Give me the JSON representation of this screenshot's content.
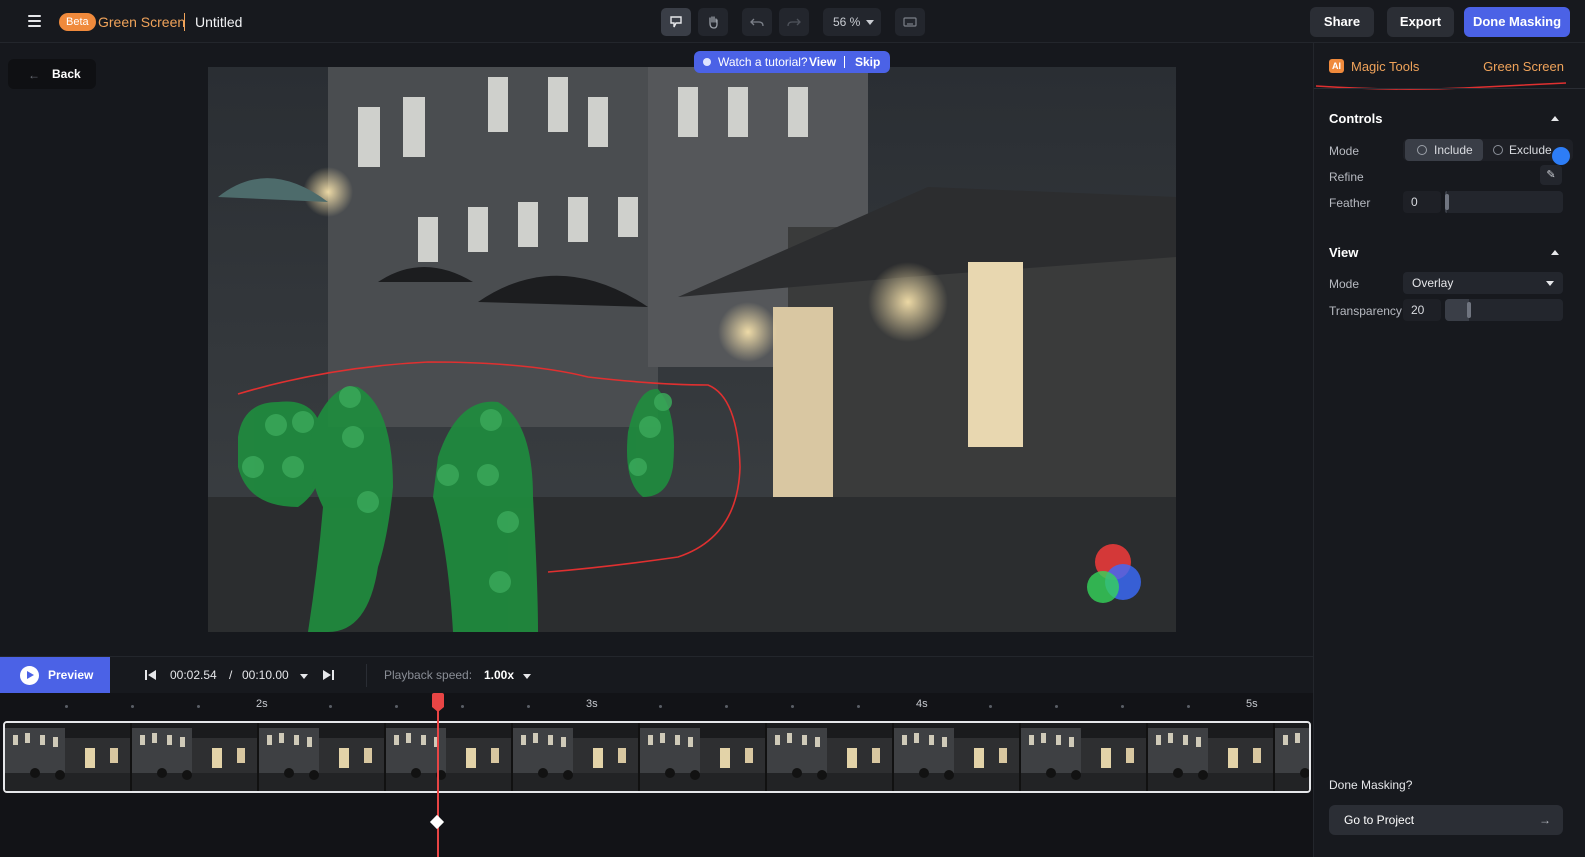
{
  "header": {
    "badge": "Beta",
    "app_name": "Green Screen",
    "doc_title": "Untitled",
    "zoom": "56 %",
    "share_label": "Share",
    "export_label": "Export",
    "done_label": "Done Masking"
  },
  "canvas": {
    "back_label": "Back",
    "back_arrow": "←",
    "tutorial_text": "Watch a tutorial?",
    "tutorial_view": "View",
    "tutorial_skip": "Skip"
  },
  "panel": {
    "ai_badge": "AI",
    "tab_magic": "Magic Tools",
    "tab_green": "Green Screen",
    "controls": {
      "title": "Controls",
      "mode_label": "Mode",
      "mode_include": "Include",
      "mode_exclude": "Exclude",
      "refine_label": "Refine",
      "feather_label": "Feather",
      "feather_value": "0",
      "feather_fraction": 0.02
    },
    "view": {
      "title": "View",
      "mode_label": "Mode",
      "mode_value": "Overlay",
      "transparency_label": "Transparency",
      "transparency_value": "20",
      "transparency_fraction": 0.2
    },
    "done_question": "Done Masking?",
    "goto_label": "Go to Project",
    "goto_arrow": "→"
  },
  "playback": {
    "preview_label": "Preview",
    "current_time": "00:02.54",
    "separator": "/",
    "total_time": "00:10.00",
    "speed_label": "Playback speed:",
    "speed_value": "1.00x"
  },
  "timeline": {
    "labels": [
      "2s",
      "3s",
      "4s",
      "5s"
    ],
    "frame_count": 11
  },
  "colors": {
    "accent": "#4b62e6",
    "brand_orange": "#f08a3c",
    "playhead": "#e84545",
    "mask_green": "#1f8c3e"
  }
}
